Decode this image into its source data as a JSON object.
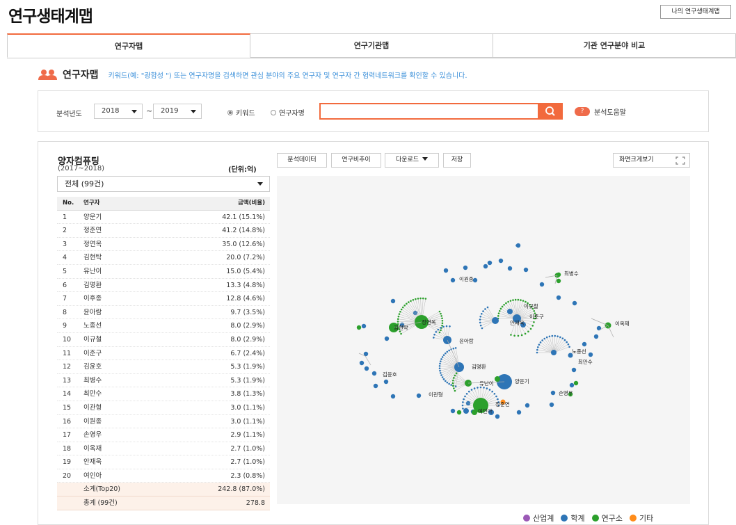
{
  "page": {
    "title": "연구생태계맵",
    "my_map_button": "나의 연구생태계맵"
  },
  "tabs": [
    {
      "label": "연구자맵",
      "active": true
    },
    {
      "label": "연구기관맵",
      "active": false
    },
    {
      "label": "기관 연구분야 비교",
      "active": false
    }
  ],
  "section": {
    "title": "연구자맵",
    "description": "키워드(예: \"광합성 \") 또는 연구자명을 검색하면 관심 분야의 주요 연구자 및 연구자 간 협력네트워크를 확인할 수 있습니다.",
    "icon": "people-icon"
  },
  "search": {
    "year_label": "분석년도",
    "year_from": "2018",
    "tilde": "~",
    "year_to": "2019",
    "radio_keyword": "키워드",
    "radio_researcher": "연구자명",
    "selected_radio": "키워드",
    "input_value": "",
    "help_badge": "?",
    "help_label": "분석도움말"
  },
  "result": {
    "field": "양자컴퓨팅",
    "period": "(2017~2018)",
    "unit": "(단위:억)",
    "filter": "전체 (99건)",
    "columns": {
      "no": "No.",
      "name": "연구자",
      "amount": "금액(비율)"
    },
    "rows": [
      {
        "no": "1",
        "name": "양운기",
        "amount": "42.1 (15.1%)"
      },
      {
        "no": "2",
        "name": "정준연",
        "amount": "41.2 (14.8%)"
      },
      {
        "no": "3",
        "name": "정연옥",
        "amount": "35.0 (12.6%)"
      },
      {
        "no": "4",
        "name": "김현탁",
        "amount": "20.0 (7.2%)"
      },
      {
        "no": "5",
        "name": "유난이",
        "amount": "15.0 (5.4%)"
      },
      {
        "no": "6",
        "name": "김명환",
        "amount": "13.3 (4.8%)"
      },
      {
        "no": "7",
        "name": "이후종",
        "amount": "12.8 (4.6%)"
      },
      {
        "no": "8",
        "name": "윤아람",
        "amount": "9.7 (3.5%)"
      },
      {
        "no": "9",
        "name": "노종선",
        "amount": "8.0 (2.9%)"
      },
      {
        "no": "10",
        "name": "이규철",
        "amount": "8.0 (2.9%)"
      },
      {
        "no": "11",
        "name": "이준구",
        "amount": "6.7 (2.4%)"
      },
      {
        "no": "12",
        "name": "김윤호",
        "amount": "5.3 (1.9%)"
      },
      {
        "no": "13",
        "name": "최병수",
        "amount": "5.3 (1.9%)"
      },
      {
        "no": "14",
        "name": "최만수",
        "amount": "3.8 (1.3%)"
      },
      {
        "no": "15",
        "name": "이관형",
        "amount": "3.0 (1.1%)"
      },
      {
        "no": "16",
        "name": "이원종",
        "amount": "3.0 (1.1%)"
      },
      {
        "no": "17",
        "name": "손영우",
        "amount": "2.9 (1.1%)"
      },
      {
        "no": "18",
        "name": "이옥재",
        "amount": "2.7 (1.0%)"
      },
      {
        "no": "19",
        "name": "안재욱",
        "amount": "2.7 (1.0%)"
      },
      {
        "no": "20",
        "name": "여인아",
        "amount": "2.3 (0.8%)"
      }
    ],
    "subtotal_label": "소계(Top20)",
    "subtotal_value": "242.8 (87.0%)",
    "total_label": "총계 (99건)",
    "total_value": "278.8"
  },
  "toolbar": {
    "analysis_data": "분석데이터",
    "trend": "연구비추이",
    "download": "다운로드",
    "save": "저장",
    "fullscreen": "화면크게보기"
  },
  "network": {
    "labels": [
      "이원종",
      "최병수",
      "이규철",
      "이준구",
      "안재욱",
      "이옥재",
      "정연옥",
      "김현탁",
      "윤아람",
      "노종선",
      "최만수",
      "김명환",
      "김윤호",
      "유난이",
      "양운기",
      "이관형",
      "손영우",
      "정준연",
      "여인아"
    ]
  },
  "legend": [
    {
      "label": "산업계",
      "color": "#9b59b6"
    },
    {
      "label": "학계",
      "color": "#2e75b6"
    },
    {
      "label": "연구소",
      "color": "#2ca02c"
    },
    {
      "label": "기타",
      "color": "#ff8c1a"
    }
  ]
}
